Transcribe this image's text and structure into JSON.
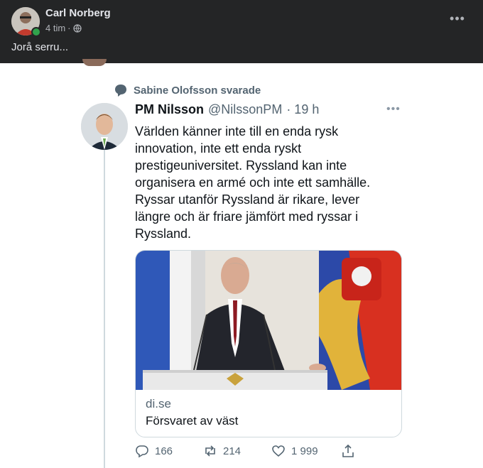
{
  "post": {
    "author": "Carl Norberg",
    "time": "4 tim",
    "separator": "·",
    "text": "Jorå serru...",
    "more": "•••"
  },
  "tweet": {
    "reply_note": "Sabine Olofsson svarade",
    "name": "PM Nilsson",
    "handle": "@NilssonPM",
    "time": "· 19 h",
    "more": "•••",
    "text": "Världen känner inte till en enda rysk innovation, inte ett enda ryskt prestigeuniversitet. Ryssland kan inte organisera en armé och inte ett samhälle. Ryssar utanför Ryssland är rikare, lever längre och är friare jämfört med ryssar i Ryssland.",
    "card": {
      "domain": "di.se",
      "title": "Försvaret av väst"
    },
    "stats": {
      "replies": "166",
      "retweets": "214",
      "likes": "1 999"
    }
  },
  "colors": {
    "fb_bg": "#242526",
    "online": "#31a24c",
    "tw_text": "#0f1419",
    "tw_muted": "#536471"
  }
}
